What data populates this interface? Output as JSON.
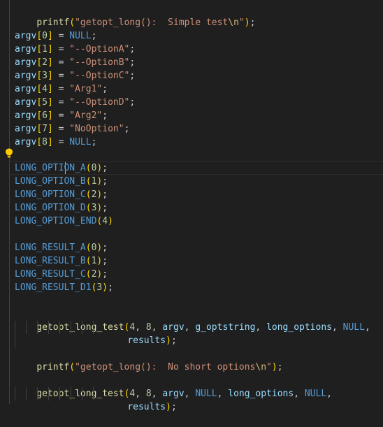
{
  "code": {
    "line1": {
      "fn": "printf",
      "open": "(",
      "str": "\"getopt_long():  Simple test",
      "esc": "\\n",
      "str_end": "\"",
      "close": ")",
      "semi": ";"
    },
    "argv_lines": [
      {
        "var": "argv",
        "ob": "[",
        "idx": "0",
        "cb": "]",
        "eq": " = ",
        "val": "NULL",
        "val_kind": "kw",
        "semi": ";"
      },
      {
        "var": "argv",
        "ob": "[",
        "idx": "1",
        "cb": "]",
        "eq": " = ",
        "val": "\"--OptionA\"",
        "val_kind": "str",
        "semi": ";"
      },
      {
        "var": "argv",
        "ob": "[",
        "idx": "2",
        "cb": "]",
        "eq": " = ",
        "val": "\"--OptionB\"",
        "val_kind": "str",
        "semi": ";"
      },
      {
        "var": "argv",
        "ob": "[",
        "idx": "3",
        "cb": "]",
        "eq": " = ",
        "val": "\"--OptionC\"",
        "val_kind": "str",
        "semi": ";"
      },
      {
        "var": "argv",
        "ob": "[",
        "idx": "4",
        "cb": "]",
        "eq": " = ",
        "val": "\"Arg1\"",
        "val_kind": "str",
        "semi": ";"
      },
      {
        "var": "argv",
        "ob": "[",
        "idx": "5",
        "cb": "]",
        "eq": " = ",
        "val": "\"--OptionD\"",
        "val_kind": "str",
        "semi": ";"
      },
      {
        "var": "argv",
        "ob": "[",
        "idx": "6",
        "cb": "]",
        "eq": " = ",
        "val": "\"Arg2\"",
        "val_kind": "str",
        "semi": ";"
      },
      {
        "var": "argv",
        "ob": "[",
        "idx": "7",
        "cb": "]",
        "eq": " = ",
        "val": "\"NoOption\"",
        "val_kind": "str",
        "semi": ";"
      },
      {
        "var": "argv",
        "ob": "[",
        "idx": "8",
        "cb": "]",
        "eq": " = ",
        "val": "NULL",
        "val_kind": "kw",
        "semi": ";"
      }
    ],
    "long_option_lines": [
      {
        "mac": "LONG_OPTION_A",
        "open": "(",
        "arg": "0",
        "close": ")",
        "semi": ";"
      },
      {
        "mac": "LONG_OPTION_B",
        "open": "(",
        "arg": "1",
        "close": ")",
        "semi": ";"
      },
      {
        "mac": "LONG_OPTION_C",
        "open": "(",
        "arg": "2",
        "close": ")",
        "semi": ";"
      },
      {
        "mac": "LONG_OPTION_D",
        "open": "(",
        "arg": "3",
        "close": ")",
        "semi": ";"
      },
      {
        "mac": "LONG_OPTION_END",
        "open": "(",
        "arg": "4",
        "close": ")",
        "semi": ""
      }
    ],
    "long_result_lines": [
      {
        "mac": "LONG_RESULT_A",
        "open": "(",
        "arg": "0",
        "close": ")",
        "semi": ";"
      },
      {
        "mac": "LONG_RESULT_B",
        "open": "(",
        "arg": "1",
        "close": ")",
        "semi": ";"
      },
      {
        "mac": "LONG_RESULT_C",
        "open": "(",
        "arg": "2",
        "close": ")",
        "semi": ";"
      },
      {
        "mac": "LONG_RESULT_D1",
        "open": "(",
        "arg": "3",
        "close": ")",
        "semi": ";"
      }
    ],
    "call1": {
      "fn": "getopt_long_test",
      "open": "(",
      "n1": "4",
      "c1": ", ",
      "n2": "8",
      "c2": ", ",
      "a1": "argv",
      "c3": ", ",
      "a2": "g_optstring",
      "c4": ", ",
      "a3": "long_options",
      "c5": ", ",
      "a4": "NULL",
      "c6": ",",
      "cont": "results",
      "close": ")",
      "semi": ";"
    },
    "line2": {
      "fn": "printf",
      "open": "(",
      "str": "\"getopt_long():  No short options",
      "esc": "\\n",
      "str_end": "\"",
      "close": ")",
      "semi": ";"
    },
    "call2": {
      "fn": "getopt_long_test",
      "open": "(",
      "n1": "4",
      "c1": ", ",
      "n2": "8",
      "c2": ", ",
      "a1": "argv",
      "c3": ", ",
      "a2": "NULL",
      "c4": ", ",
      "a3": "long_options",
      "c5": ", ",
      "a4": "NULL",
      "c6": ",",
      "cont": "results",
      "close": ")",
      "semi": ";"
    }
  },
  "colors": {
    "background": "#1f1f1f",
    "function": "#dcdcaa",
    "string": "#ce9178",
    "variable": "#9cdcfe",
    "number": "#b5cea8",
    "keyword": "#569cd6",
    "bracket_gold": "#ffd700",
    "bracket_purple": "#da70d6"
  },
  "icons": {
    "lightbulb": "lightbulb-icon"
  }
}
